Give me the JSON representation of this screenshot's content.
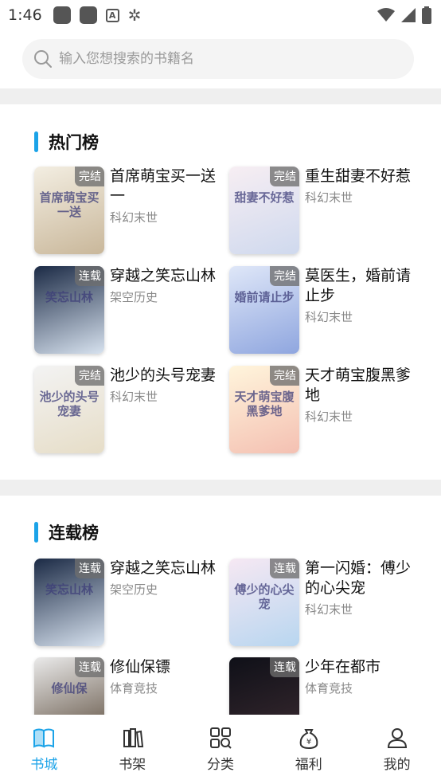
{
  "status": {
    "time": "1:46"
  },
  "search": {
    "placeholder": "输入您想搜索的书籍名"
  },
  "hot": {
    "title": "热门榜",
    "books": [
      {
        "title": "首席萌宝买一送一",
        "category": "科幻末世",
        "status": "完结",
        "cover_text": "首席萌宝买一送",
        "colors": [
          "#f3eee2",
          "#c9b79a"
        ]
      },
      {
        "title": "重生甜妻不好惹",
        "category": "科幻末世",
        "status": "完结",
        "cover_text": "甜妻不好惹",
        "colors": [
          "#f7eef3",
          "#cfd9ee"
        ]
      },
      {
        "title": "穿越之笑忘山林",
        "category": "架空历史",
        "status": "连载",
        "cover_text": "笑忘山林",
        "colors": [
          "#1b2a45",
          "#d7e2ef"
        ]
      },
      {
        "title": "莫医生，婚前请止步",
        "category": "科幻末世",
        "status": "完结",
        "cover_text": "婚前请止步",
        "colors": [
          "#dfe7f8",
          "#8fa6df"
        ]
      },
      {
        "title": "池少的头号宠妻",
        "category": "科幻末世",
        "status": "完结",
        "cover_text": "池少的头号宠妻",
        "colors": [
          "#f3f3f3",
          "#e6ddc7"
        ]
      },
      {
        "title": "天才萌宝腹黑爹地",
        "category": "科幻末世",
        "status": "完结",
        "cover_text": "天才萌宝腹黑爹地",
        "colors": [
          "#fff5dc",
          "#f4c0b2"
        ]
      }
    ]
  },
  "serial": {
    "title": "连载榜",
    "books": [
      {
        "title": "穿越之笑忘山林",
        "category": "架空历史",
        "status": "连载",
        "cover_text": "笑忘山林",
        "colors": [
          "#1b2a45",
          "#d7e2ef"
        ]
      },
      {
        "title": "第一闪婚：傅少的心尖宠",
        "category": "科幻末世",
        "status": "连载",
        "cover_text": "傅少的心尖宠",
        "colors": [
          "#f6e8f3",
          "#b8d6f0"
        ]
      },
      {
        "title": "修仙保镖",
        "category": "体育竞技",
        "status": "连载",
        "cover_text": "修仙保",
        "colors": [
          "#eaeaea",
          "#5a4a3a"
        ]
      },
      {
        "title": "少年在都市",
        "category": "体育竞技",
        "status": "连载",
        "cover_text": "",
        "colors": [
          "#0f1018",
          "#3a2a30"
        ]
      }
    ]
  },
  "tabs": [
    {
      "label": "书城",
      "icon": "book-open-icon",
      "active": true
    },
    {
      "label": "书架",
      "icon": "bookshelf-icon",
      "active": false
    },
    {
      "label": "分类",
      "icon": "category-grid-icon",
      "active": false
    },
    {
      "label": "福利",
      "icon": "money-bag-icon",
      "active": false
    },
    {
      "label": "我的",
      "icon": "user-icon",
      "active": false
    }
  ],
  "colors": {
    "accent": "#1ba3e8",
    "badge": "#6e6e6e"
  }
}
